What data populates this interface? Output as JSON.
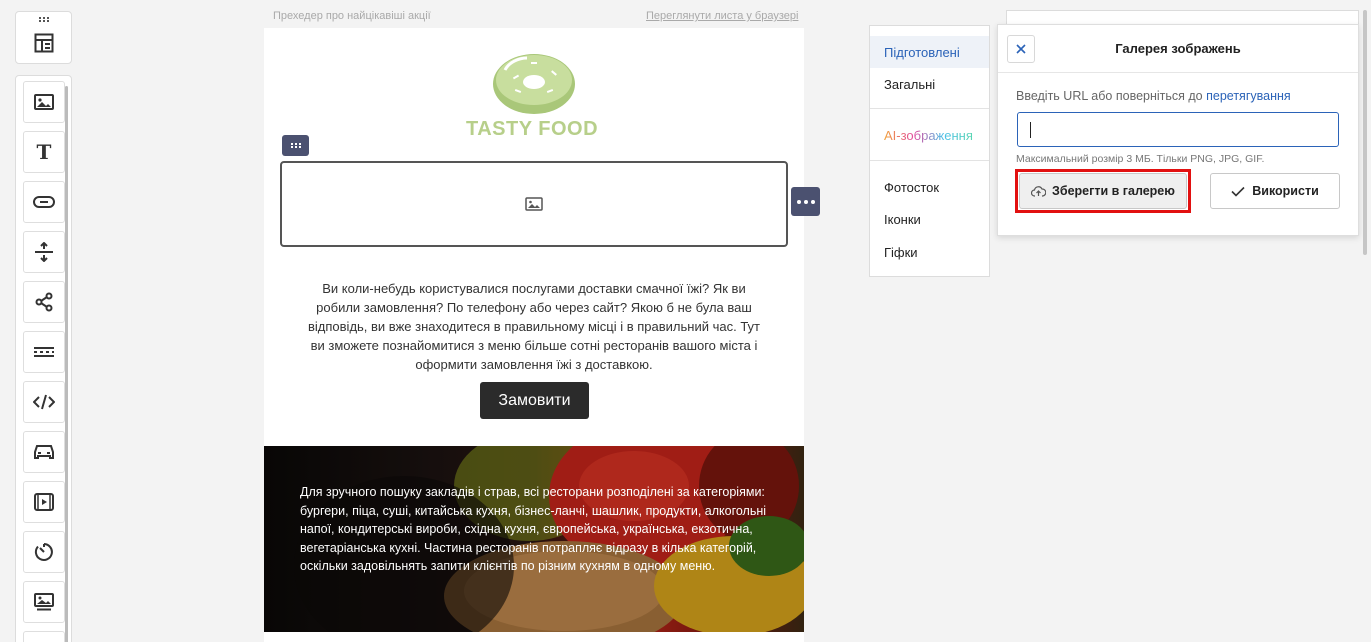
{
  "email": {
    "preheader": "Прехедер про найцікавіші акції",
    "view_in_browser": "Переглянути листа у браузері",
    "brand_name": "TASTY FOOD",
    "paragraph": "Ви коли-небудь користувалися послугами доставки смачної їжі? Як ви робили замовлення? По телефону або через сайт? Якою б не була ваш відповідь, ви вже знаходитеся в правильному місці і в правильний час. Тут ви зможете познайомитися з меню більше сотні ресторанів вашого міста і оформити замовлення їжі з доставкою.",
    "order_button": "Замовити",
    "banner_text": "Для зручного пошуку закладів і страв, всі ресторани розподілені за категоріями: бургери, піца, суші, китайська кухня, бізнес-ланчі, шашлик, продукти, алкогольні напої, кондитерські вироби, східна кухня, європейська, українська, екзотична, вегетаріанська кухні. Частина ресторанів потрапляє відразу в кілька категорій, оскільки задовільнять запити клієнтів по різним кухням в одному меню."
  },
  "tabs": [
    {
      "label": "Підготовлені",
      "active": true
    },
    {
      "label": "Загальні"
    },
    {
      "label": "AI-зображення"
    },
    {
      "label": "Фотосток"
    },
    {
      "label": "Іконки"
    },
    {
      "label": "Гіфки"
    }
  ],
  "gallery": {
    "title": "Галерея зображень",
    "hint_text": "Введіть URL або поверніться до",
    "hint_link": "перетягування",
    "url_value": "",
    "size_note": "Максимальний розмір 3 МБ. Тільки PNG, JPG, GIF.",
    "save_button": "Зберегти в галерею",
    "use_button": "Використи"
  },
  "toolbar": {
    "tools": [
      "image-icon",
      "text-icon",
      "button-icon",
      "spacer-icon",
      "social-icon",
      "divider-icon",
      "html-icon",
      "product-icon",
      "video-icon",
      "timer-icon",
      "image-gallery-icon"
    ]
  },
  "colors": {
    "accent": "#2b63b8",
    "handle": "#4b5170",
    "highlight": "#e21010",
    "brand": "#b7cf8a"
  }
}
